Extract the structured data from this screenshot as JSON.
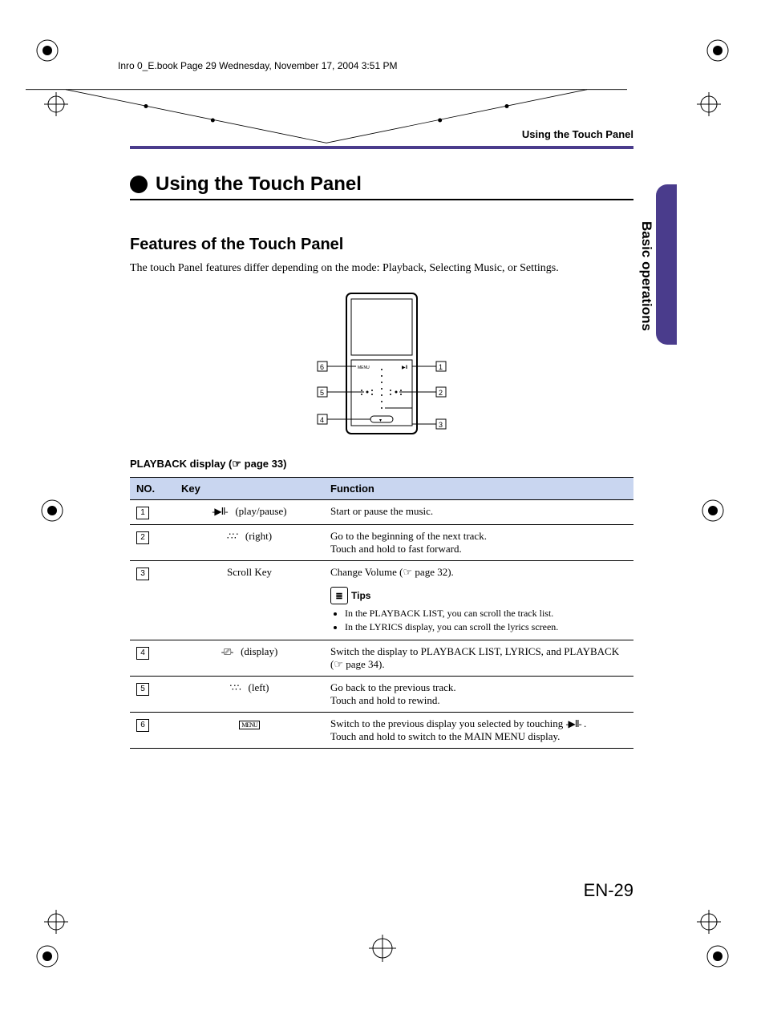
{
  "header_line": "Inro 0_E.book  Page 29  Wednesday, November 17, 2004  3:51 PM",
  "running_head": "Using the Touch Panel",
  "main_title": "Using the Touch Panel",
  "side_label": "Basic operations",
  "h2": "Features of the Touch Panel",
  "intro": "The touch Panel features differ depending on the mode: Playback, Selecting Music, or Settings.",
  "figure": {
    "labels": [
      "1",
      "2",
      "3",
      "4",
      "5",
      "6"
    ],
    "menu_label": "MENU"
  },
  "playback_caption_prefix": "PLAYBACK display (",
  "playback_caption_suffix": " page 33)",
  "table": {
    "headers": {
      "no": "NO.",
      "key": "Key",
      "func": "Function"
    },
    "rows": [
      {
        "no": "1",
        "key_label": "(play/pause)",
        "key_icon": "play-pause",
        "func_lines": [
          "Start or pause the music."
        ]
      },
      {
        "no": "2",
        "key_label": "(right)",
        "key_icon": "touch",
        "func_lines": [
          "Go to the beginning of the next track.",
          "Touch and hold to fast forward."
        ]
      },
      {
        "no": "3",
        "key_label": "Scroll Key",
        "key_icon": "",
        "func_first": "Change Volume (",
        "func_first_suffix": " page 32).",
        "tips_label": "Tips",
        "tips": [
          "In the PLAYBACK LIST, you can scroll the track list.",
          "In the LYRICS display, you can scroll the lyrics screen."
        ]
      },
      {
        "no": "4",
        "key_label": "(display)",
        "key_icon": "display",
        "func_first": "Switch the display to PLAYBACK LIST, LYRICS, and PLAYBACK (",
        "func_first_suffix": " page 34)."
      },
      {
        "no": "5",
        "key_label": "(left)",
        "key_icon": "touch",
        "func_lines": [
          "Go back to the previous track.",
          "Touch and hold to rewind."
        ]
      },
      {
        "no": "6",
        "key_label": "",
        "key_icon": "menu",
        "func_lines_inline": {
          "prefix": "Switch to the previous display you selected by touching ",
          "suffix": " ."
        },
        "func_lines": [
          "Touch and hold to switch to the MAIN MENU display."
        ]
      }
    ]
  },
  "page_number": "EN-29"
}
